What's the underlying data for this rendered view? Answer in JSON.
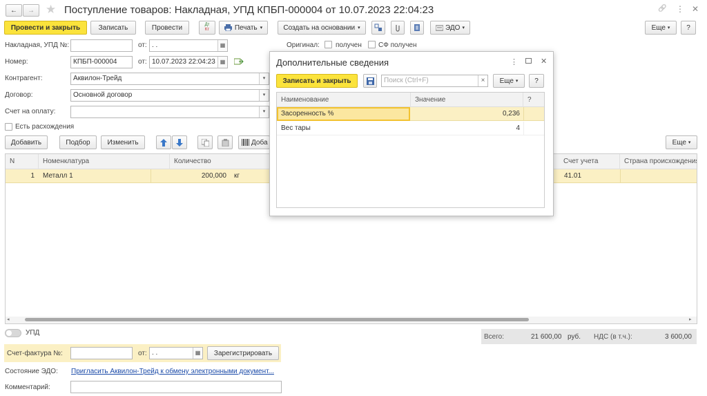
{
  "window": {
    "title": "Поступление товаров: Накладная, УПД КПБП-000004 от 10.07.2023 22:04:23",
    "back_label": "←",
    "forward_label": "→",
    "star_label": "★",
    "link_label": "🔗",
    "more_label": "⋮",
    "close_label": "✕"
  },
  "toolbar": {
    "post_close": "Провести и закрыть",
    "save": "Записать",
    "post": "Провести",
    "dtkt_top": "Дт",
    "dtkt_bottom": "Кт",
    "print": "Печать",
    "create_based": "Создать на основании",
    "edo": "ЭДО",
    "more": "Еще",
    "help": "?"
  },
  "form": {
    "invoice_label": "Накладная, УПД №:",
    "invoice_value": "",
    "from_label": "от:",
    "invoice_date": " .  .",
    "original_label": "Оригинал:",
    "received_label": "получен",
    "sf_received_label": "СФ получен",
    "number_label": "Номер:",
    "number_value": "КПБП-000004",
    "number_date": "10.07.2023 22:04:23",
    "counterparty_label": "Контрагент:",
    "counterparty_value": "Аквилон-Трейд",
    "contract_label": "Договор:",
    "contract_value": "Основной договор",
    "payment_label": "Счет на оплату:",
    "payment_value": "",
    "discrepancy_label": "Есть расхождения"
  },
  "items_toolbar": {
    "add": "Добавить",
    "select": "Подбор",
    "change": "Изменить",
    "add2": "Доба",
    "more": "Еще"
  },
  "table": {
    "headers": {
      "n": "N",
      "nomenclature": "Номенклатура",
      "quantity": "Количество",
      "account": "Счет учета",
      "country": "Страна происхождения"
    },
    "rows": [
      {
        "n": "1",
        "nomenclature": "Металл 1",
        "quantity": "200,000",
        "unit": "кг",
        "account": "41.01",
        "country": ""
      }
    ]
  },
  "footer": {
    "upd_label": "УПД",
    "sf_label": "Счет-фактура №:",
    "sf_value": "",
    "sf_from": "от:",
    "sf_date": " .  .",
    "register": "Зарегистрировать",
    "edo_state_label": "Состояние ЭДО:",
    "edo_state_link": "Пригласить Аквилон-Трейд к обмену электронными документ...",
    "comment_label": "Комментарий:",
    "comment_value": "",
    "total_label": "Всего:",
    "total_value": "21 600,00",
    "currency": "руб.",
    "vat_label": "НДС (в т.ч.):",
    "vat_value": "3 600,00"
  },
  "dialog": {
    "title": "Дополнительные сведения",
    "save_close": "Записать и закрыть",
    "search_placeholder": "Поиск (Ctrl+F)",
    "clear": "×",
    "more": "Еще",
    "help": "?",
    "col_name": "Наименование",
    "col_value": "Значение",
    "col_q": "?",
    "rows": [
      {
        "name": "Засоренность %",
        "value": "0,236"
      },
      {
        "name": "Вес тары",
        "value": "4"
      }
    ]
  },
  "colors": {
    "accent_yellow": "#fbe33c",
    "selected_row": "#fbf0c4",
    "link": "#1a4aa8"
  }
}
